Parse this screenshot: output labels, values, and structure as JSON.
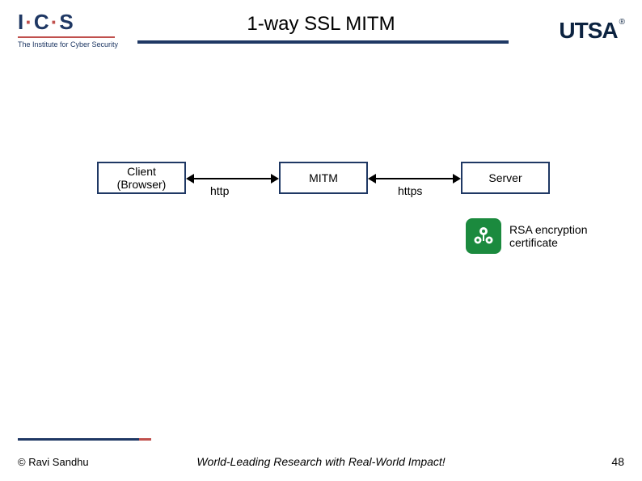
{
  "header": {
    "left_logo_main": "I·C·S",
    "left_logo_sub": "The Institute for Cyber Security",
    "title": "1-way SSL MITM",
    "right_logo": "UTSA"
  },
  "diagram": {
    "client_label": "Client\n(Browser)",
    "mitm_label": "MITM",
    "server_label": "Server",
    "link_left_label": "http",
    "link_right_label": "https",
    "cert_label": "RSA encryption\ncertificate",
    "cert_icon_name": "keys-certificate-icon"
  },
  "footer": {
    "copyright": "© Ravi Sandhu",
    "tagline": "World-Leading Research with Real-World Impact!",
    "page_number": "48"
  }
}
